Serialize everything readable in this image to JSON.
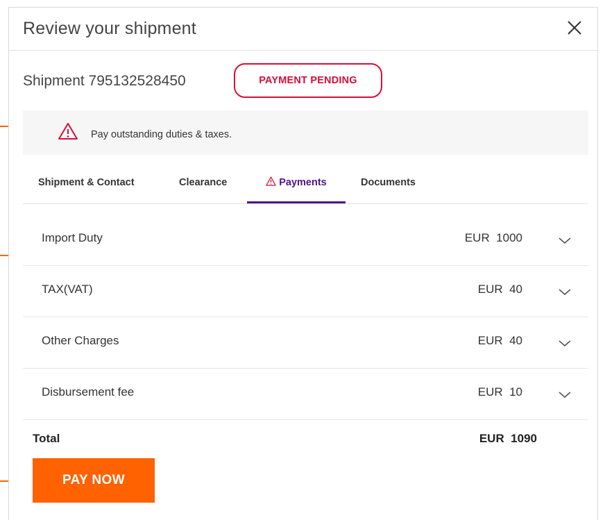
{
  "modal": {
    "title": "Review your shipment",
    "close_icon": "close-icon"
  },
  "shipment": {
    "label": "Shipment 795132528450",
    "status": "PAYMENT PENDING",
    "status_color": "#d40e3a"
  },
  "alert": {
    "icon": "warning-icon",
    "message": "Pay outstanding duties & taxes."
  },
  "tabs": [
    {
      "label": "Shipment & Contact",
      "active": false
    },
    {
      "label": "Clearance",
      "active": false
    },
    {
      "label": "Payments",
      "active": true,
      "icon": "warning-icon"
    },
    {
      "label": "Documents",
      "active": false
    }
  ],
  "charges": [
    {
      "label": "Import Duty",
      "amount": "EUR  1000",
      "icon": "chevron-down-icon"
    },
    {
      "label": "TAX(VAT)",
      "amount": "EUR  40",
      "icon": "chevron-down-icon"
    },
    {
      "label": "Other Charges",
      "amount": "EUR  40",
      "icon": "chevron-down-icon"
    },
    {
      "label": "Disbursement fee",
      "amount": "EUR  10",
      "icon": "chevron-down-icon"
    }
  ],
  "total": {
    "label": "Total",
    "amount": "EUR  1090"
  },
  "pay_button": {
    "label": "PAY NOW"
  },
  "colors": {
    "accent_orange": "#ff6200",
    "active_tab_purple": "#4d148c",
    "alert_red": "#d40e3a"
  }
}
